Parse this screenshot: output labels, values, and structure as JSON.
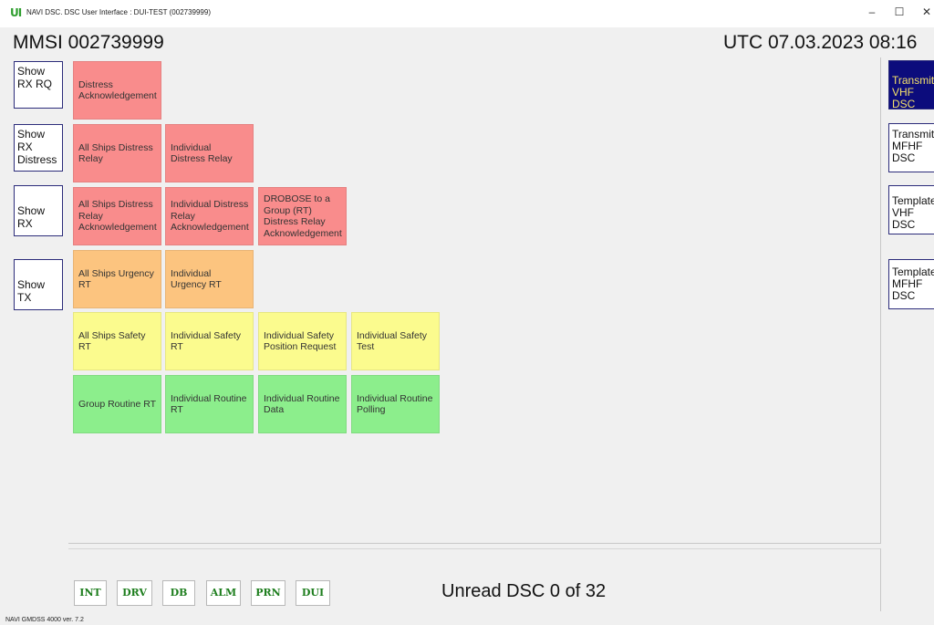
{
  "window": {
    "icon_text": "UI",
    "title": "NAVI DSC. DSC User Interface : DUI-TEST (002739999)",
    "minimize": "–",
    "maximize": "☐",
    "close": "✕"
  },
  "header": {
    "mmsi": "MMSI 002739999",
    "utc": "UTC 07.03.2023 08:16"
  },
  "left_buttons": [
    "Show RX RQ",
    "Show RX Distress",
    "Show RX",
    "Show TX"
  ],
  "tiles": {
    "distress_ack": "Distress Acknowledgement",
    "all_ships_distress_relay": "All Ships Distress Relay",
    "individual_distress_relay": "Individual Distress Relay",
    "all_ships_distress_relay_ack": "All Ships Distress Relay Acknowledgement",
    "individual_distress_relay_ack": "Individual Distress Relay Acknowledgement",
    "drobose_group": "DROBOSE to a Group (RT) Distress Relay Acknowledgement",
    "all_ships_urgency": "All Ships Urgency RT",
    "individual_urgency": "Individual Urgency RT",
    "all_ships_safety": "All Ships Safety RT",
    "individual_safety": "Individual Safety RT",
    "individual_safety_position": "Individual Safety Position Request",
    "individual_safety_test": "Individual Safety Test",
    "group_routine": "Group Routine RT",
    "individual_routine": "Individual Routine RT",
    "individual_routine_data": "Individual Routine Data",
    "individual_routine_polling": "Individual Routine Polling"
  },
  "right_buttons": [
    "Transmit VHF DSC",
    "Transmit MFHF DSC",
    "Template VHF DSC",
    "Template MFHF DSC"
  ],
  "bottom": {
    "buttons": [
      "INT",
      "DRV",
      "DB",
      "ALM",
      "PRN",
      "DUI"
    ],
    "unread": "Unread DSC 0 of 32"
  },
  "status": {
    "version": "NAVI GMDSS 4000 ver. 7.2"
  },
  "colors": {
    "distress": "#f98c8c",
    "urgency": "#fcc47f",
    "safety": "#fbfb8e",
    "routine": "#8cee8c",
    "active_button_bg": "#0c0c7c",
    "active_button_text": "#f3e06a"
  }
}
